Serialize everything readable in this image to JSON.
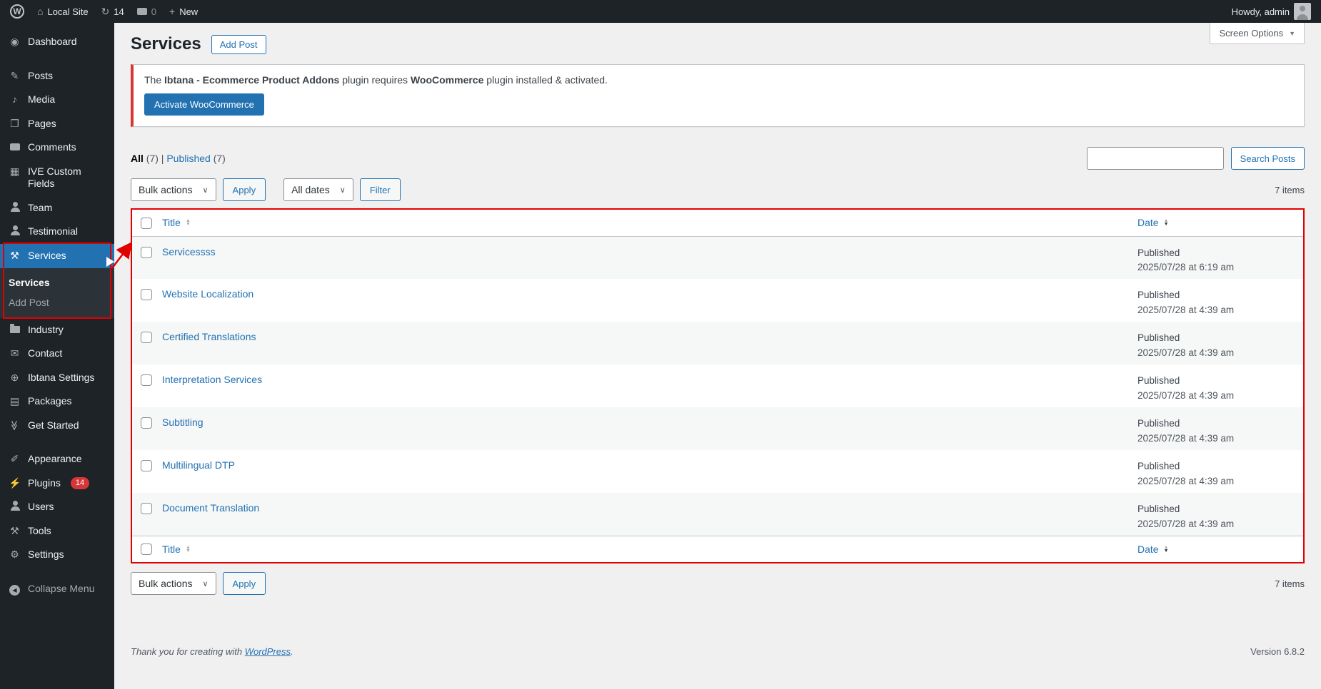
{
  "colors": {
    "accent": "#2271b1",
    "annotation_red": "#e10000",
    "wp_red": "#d63638",
    "menu_bg": "#1d2327",
    "content_bg": "#f0f0f1"
  },
  "icons": {
    "wp_logo": "W",
    "home": "⌂",
    "updates": "↻",
    "new_plus": "+",
    "caret_down": "▼",
    "chevron_down": "∨",
    "sort_up": "▲",
    "sort_down": "▼"
  },
  "admin_bar": {
    "site_name": "Local Site",
    "updates_count": "14",
    "comments_count": "0",
    "new_label": "New",
    "howdy": "Howdy, admin"
  },
  "sidebar": {
    "items": [
      {
        "label": "Dashboard",
        "glyph": "◉"
      },
      {
        "label": "Posts",
        "glyph": "✎"
      },
      {
        "label": "Media",
        "glyph": "♪"
      },
      {
        "label": "Pages",
        "glyph": "❐"
      },
      {
        "label": "Comments",
        "glyph": ""
      },
      {
        "label": "IVE Custom Fields",
        "glyph": "▦"
      },
      {
        "label": "Team",
        "glyph": ""
      },
      {
        "label": "Testimonial",
        "glyph": ""
      },
      {
        "label": "Services",
        "glyph": "⚒"
      },
      {
        "label": "Industry",
        "glyph": ""
      },
      {
        "label": "Contact",
        "glyph": "✉"
      },
      {
        "label": "Ibtana Settings",
        "glyph": "⊕"
      },
      {
        "label": "Packages",
        "glyph": "▤"
      },
      {
        "label": "Get Started",
        "glyph": "≫"
      },
      {
        "label": "Appearance",
        "glyph": "✐"
      },
      {
        "label": "Plugins",
        "glyph": "⚡",
        "badge": "14"
      },
      {
        "label": "Users",
        "glyph": ""
      },
      {
        "label": "Tools",
        "glyph": "⚒"
      },
      {
        "label": "Settings",
        "glyph": "⚙"
      },
      {
        "label": "Collapse Menu",
        "glyph": "◀"
      }
    ],
    "submenu": {
      "services_label": "Services",
      "add_post_label": "Add Post"
    }
  },
  "page": {
    "title": "Services",
    "add_post_label": "Add Post",
    "screen_options_label": "Screen Options"
  },
  "notice": {
    "text_prefix": "The ",
    "plugin_name": "Ibtana - Ecommerce Product Addons",
    "text_middle": " plugin requires ",
    "requirement_name": "WooCommerce",
    "text_suffix": " plugin installed & activated.",
    "button_label": "Activate WooCommerce"
  },
  "filters": {
    "all_label": "All",
    "all_count": "(7)",
    "separator": "|",
    "published_label": "Published",
    "published_count": "(7)"
  },
  "search": {
    "input_value": "",
    "button_label": "Search Posts"
  },
  "tablenav": {
    "bulk_actions_label": "Bulk actions",
    "apply_label": "Apply",
    "all_dates_label": "All dates",
    "filter_label": "Filter",
    "items_count": "7 items"
  },
  "table": {
    "title_header": "Title",
    "date_header": "Date",
    "rows": [
      {
        "title": "Servicessss",
        "status": "Published",
        "date": "2025/07/28 at 6:19 am"
      },
      {
        "title": "Website Localization",
        "status": "Published",
        "date": "2025/07/28 at 4:39 am"
      },
      {
        "title": "Certified Translations",
        "status": "Published",
        "date": "2025/07/28 at 4:39 am"
      },
      {
        "title": "Interpretation Services",
        "status": "Published",
        "date": "2025/07/28 at 4:39 am"
      },
      {
        "title": "Subtitling",
        "status": "Published",
        "date": "2025/07/28 at 4:39 am"
      },
      {
        "title": "Multilingual DTP",
        "status": "Published",
        "date": "2025/07/28 at 4:39 am"
      },
      {
        "title": "Document Translation",
        "status": "Published",
        "date": "2025/07/28 at 4:39 am"
      }
    ]
  },
  "footer": {
    "thanks_prefix": "Thank you for creating with ",
    "wordpress_link": "WordPress",
    "thanks_suffix": ".",
    "version": "Version 6.8.2"
  }
}
